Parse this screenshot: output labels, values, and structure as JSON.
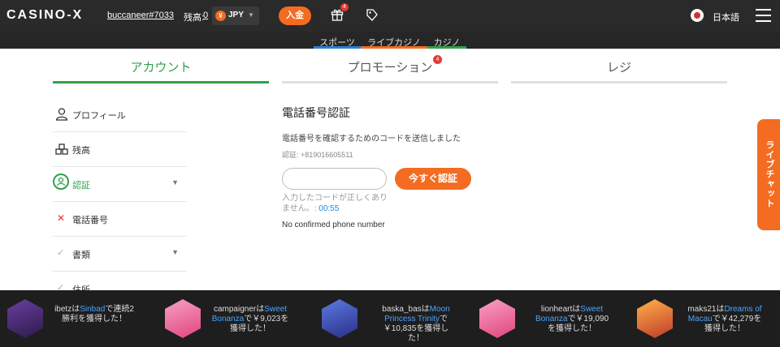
{
  "header": {
    "logo": "CASINO-X",
    "username": "buccaneer#7033",
    "balance_label": "残高:",
    "balance_value": "0",
    "currency_symbol": "¥",
    "currency": "JPY",
    "deposit_label": "入金",
    "gift_badge": "4",
    "language": "日本語",
    "icons": [
      "gift-icon",
      "promo-tag-icon",
      "japan-flag-icon",
      "hamburger-menu-icon"
    ]
  },
  "subnav": {
    "items": [
      {
        "label": "スポーツ",
        "color": "#2a7fd4"
      },
      {
        "label": "ライブカジノ",
        "color": "#f36c21"
      },
      {
        "label": "カジノ",
        "color": "#2fa14a"
      }
    ]
  },
  "tabs": [
    {
      "label": "アカウント",
      "active": true
    },
    {
      "label": "プロモーション",
      "badge": "4"
    },
    {
      "label": "レジ"
    }
  ],
  "sidebar": {
    "items": [
      {
        "label": "プロフィール",
        "icon": "user-icon"
      },
      {
        "label": "残高",
        "icon": "coins-icon"
      },
      {
        "label": "認証",
        "icon": "verify-user-icon",
        "active": true
      },
      {
        "label": "電話番号",
        "icon": "x-icon"
      },
      {
        "label": "書類",
        "icon": "check-icon"
      },
      {
        "label": "住所",
        "icon": "check-icon"
      }
    ]
  },
  "main": {
    "title": "電話番号認証",
    "description": "電話番号を確認するためのコードを送信しました",
    "verify_number": "認証: +819016605511",
    "input_value": "",
    "verify_button": "今すぐ認証",
    "error_text": "入力したコードが正しくありません。:",
    "timer": "00:55",
    "no_phone": "No confirmed phone number"
  },
  "livechat": {
    "label": "ライブチャット"
  },
  "winners": [
    {
      "user": "ibetz",
      "pre": "は",
      "game": "Sinbad",
      "post": "で連続2勝利を獲得した！"
    },
    {
      "user": "campaigner",
      "pre": "は",
      "game": "Sweet Bonanza",
      "post": "で￥9,023を獲得した！"
    },
    {
      "user": "baska_bas",
      "pre": "は",
      "game": "Moon Princess Trinity",
      "post": "で￥10,835を獲得した！"
    },
    {
      "user": "lionheart",
      "pre": "は",
      "game": "Sweet Bonanza",
      "post": "で￥19,090を獲得した！"
    },
    {
      "user": "maks21",
      "pre": "は",
      "game": "Dreams of Macau",
      "post": "で￥42,279を獲得した！"
    }
  ],
  "colors": {
    "accent_orange": "#f36c21",
    "active_green": "#2fa14a",
    "header_bg": "#2a2a2a",
    "link_blue": "#4aa3ff"
  }
}
